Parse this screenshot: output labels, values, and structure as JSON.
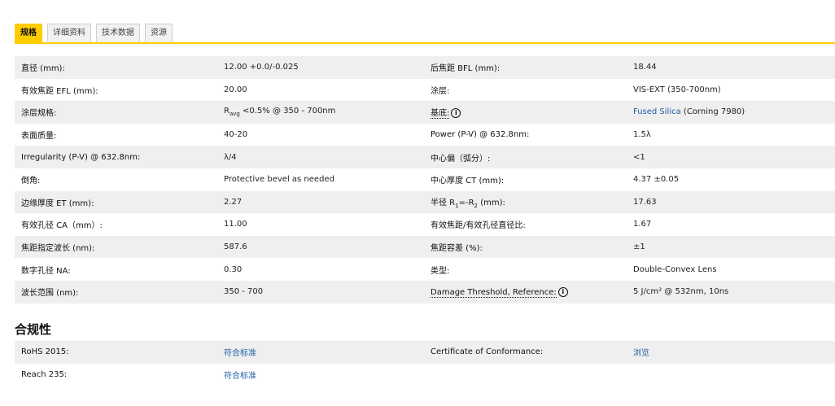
{
  "tabs": [
    {
      "label": "规格",
      "active": true
    },
    {
      "label": "详细资料",
      "active": false
    },
    {
      "label": "技术数据",
      "active": false
    },
    {
      "label": "资源",
      "active": false
    }
  ],
  "specs": [
    {
      "l1": "直径 (mm):",
      "v1": "12.00 +0.0/-0.025",
      "l2": "后焦距 BFL (mm):",
      "v2": "18.44"
    },
    {
      "l1": "有效焦距 EFL (mm):",
      "v1": "20.00",
      "l2": "涂层:",
      "v2": "VIS-EXT (350-700nm)"
    },
    {
      "l1": "涂层规格:",
      "v1_pre": "R",
      "v1_sub": "avg",
      "v1_post": " <0.5% @ 350 - 700nm",
      "l2": "基底:",
      "v2_link": "Fused Silica",
      "v2_rest": " (Corning 7980)"
    },
    {
      "l1": "表面质量:",
      "v1": "40-20",
      "l2": "Power (P-V) @ 632.8nm:",
      "v2": "1.5λ"
    },
    {
      "l1": "Irregularity (P-V) @ 632.8nm:",
      "v1": "λ/4",
      "l2": "中心偏（弧分）:",
      "v2": "<1"
    },
    {
      "l1": "倒角:",
      "v1": "Protective bevel as needed",
      "l2": "中心厚度 CT (mm):",
      "v2": "4.37 ±0.05"
    },
    {
      "l1": "边缘厚度 ET (mm):",
      "v1": "2.27",
      "l2_pre": "半径 R",
      "l2_sub1": "1",
      "l2_mid": "=-R",
      "l2_sub2": "2",
      "l2_post": " (mm):",
      "v2": "17.63"
    },
    {
      "l1": "有效孔径 CA（mm）:",
      "v1": "11.00",
      "l2": "有效焦距/有效孔径直径比:",
      "v2": "1.67"
    },
    {
      "l1": "焦距指定波长 (nm):",
      "v1": "587.6",
      "l2": "焦距容差 (%):",
      "v2": "±1"
    },
    {
      "l1": "数字孔径 NA:",
      "v1": "0.30",
      "l2": "类型:",
      "v2": "Double-Convex Lens"
    },
    {
      "l1": "波长范围 (nm):",
      "v1": "350 - 700",
      "l2": "Damage Threshold, Reference:",
      "v2": "5 J/cm² @ 532nm, 10ns"
    }
  ],
  "info_icon_glyph": "i",
  "compliance": {
    "title": "合规性",
    "rows": [
      {
        "l1": "RoHS 2015:",
        "v1": "符合标准",
        "l2": "Certificate of Conformance:",
        "v2": "浏览"
      },
      {
        "l1": "Reach 235:",
        "v1": "符合标准",
        "l2": "",
        "v2": ""
      }
    ]
  }
}
